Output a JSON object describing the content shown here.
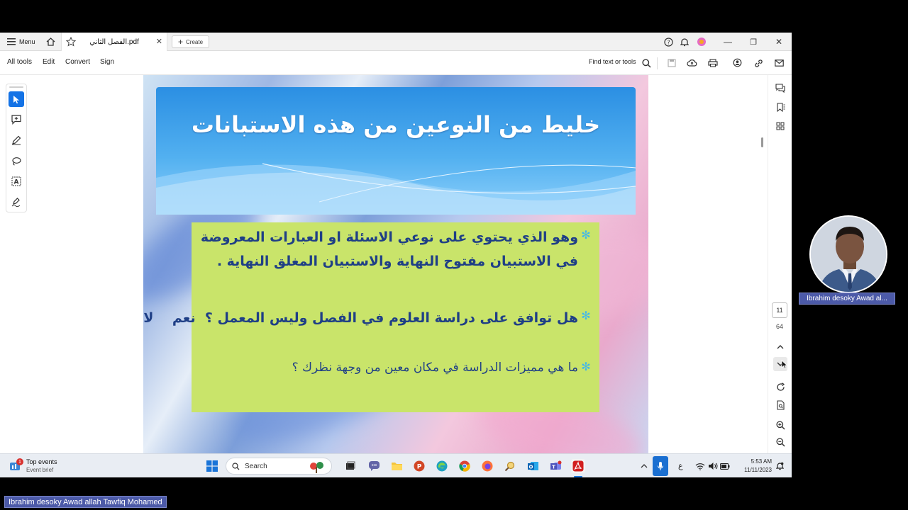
{
  "titlebar": {
    "menu_label": "Menu",
    "tab_title": "الفصل الثاني.pdf",
    "create_label": "Create"
  },
  "toolbar": {
    "items": [
      "All tools",
      "Edit",
      "Convert",
      "Sign"
    ],
    "find_placeholder": "Find text or tools"
  },
  "slide": {
    "title": "خليط من النوعين من هذه الاستبانات",
    "bullets": [
      "وهو الذي يحتوي على نوعي الاسئلة او العبارات المعروضة في الاستبيان مفتوح النهاية والاستبيان المغلق النهاية .",
      "هل توافق على دراسة العلوم في الفصل وليس المعمل ؟  نعم    لا",
      "ما هي مميزات الدراسة في مكان معين من وجهة نظرك ؟"
    ]
  },
  "pagination": {
    "current": "11",
    "total": "64"
  },
  "taskbar": {
    "events_badge": "1",
    "events_title": "Top events",
    "events_subtitle": "Event brief",
    "search_label": "Search",
    "ime": "ع",
    "time": "5:53 AM",
    "date": "11/11/2023"
  },
  "webcam": {
    "name_label": "Ibrahim desoky Awad al..."
  },
  "caption": {
    "full_name": "Ibrahim desoky Awad allah Tawfiq Mohamed"
  },
  "colors": {
    "accent_blue": "#1473e6",
    "title_banner": "#3aa0ea",
    "content_box": "#c9e46a",
    "bullet_text": "#1f3f86",
    "bullet_star": "#43b8e8",
    "name_tag": "#4c5aa8"
  }
}
